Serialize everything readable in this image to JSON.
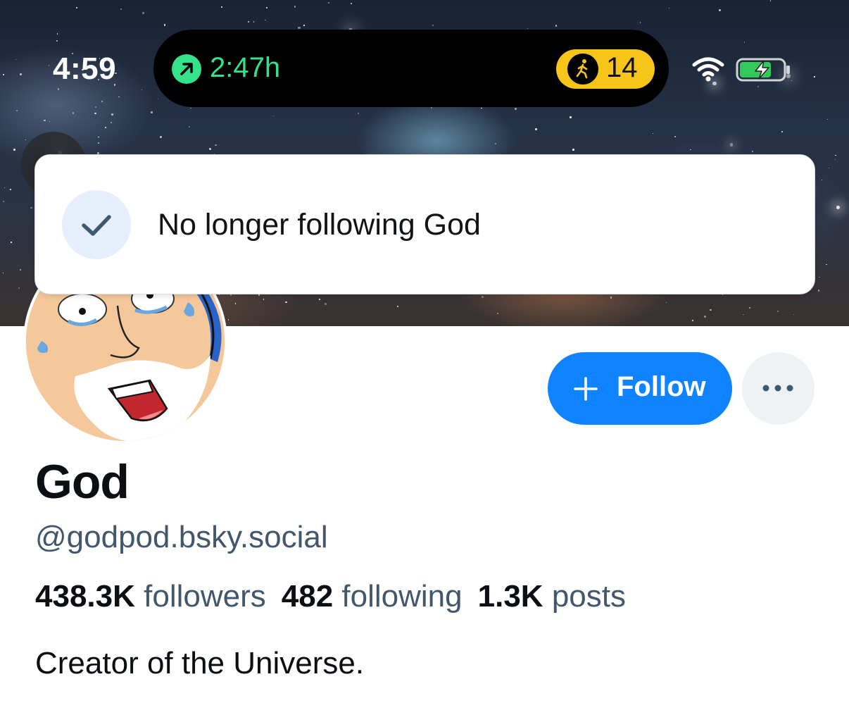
{
  "status_bar": {
    "time": "4:59",
    "activity_timer": "2:47h",
    "step_count": "14",
    "timer_icon": "arrow-up-right-icon",
    "steps_icon": "walking-person-icon",
    "wifi_icon": "wifi-icon",
    "battery_icon": "battery-charging-icon",
    "colors": {
      "timer": "#34e28a",
      "steps_pill": "#f7c51a"
    }
  },
  "toast": {
    "message": "No longer following God",
    "icon": "check-icon"
  },
  "profile": {
    "display_name": "God",
    "handle": "@godpod.bsky.social",
    "stats": {
      "followers_count": "438.3K",
      "followers_label": "followers",
      "following_count": "482",
      "following_label": "following",
      "posts_count": "1.3K",
      "posts_label": "posts"
    },
    "bio": "Creator of the Universe."
  },
  "actions": {
    "follow_label": "Follow",
    "follow_icon": "plus-icon",
    "more_icon": "ellipsis-icon",
    "accent_color": "#1083fe"
  }
}
